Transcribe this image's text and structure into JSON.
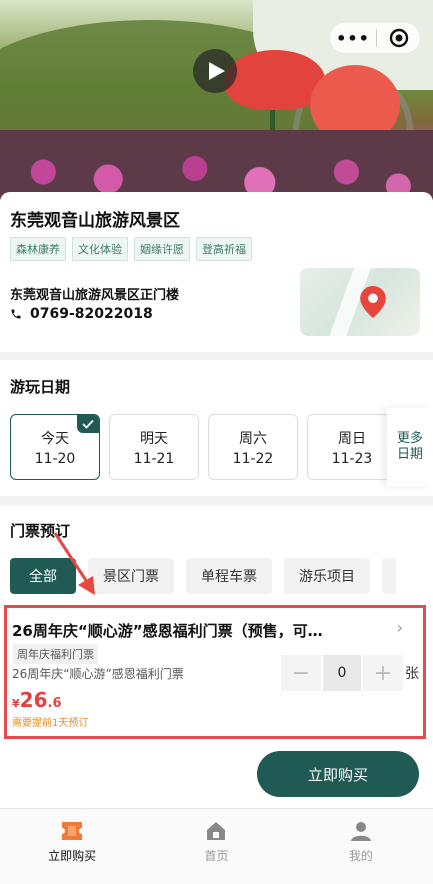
{
  "capsule": {
    "more_icon": "more-dots-icon",
    "close_icon": "close-circle-icon"
  },
  "scenic": {
    "title": "东莞观音山旅游风景区",
    "tags": [
      "森林康养",
      "文化体验",
      "姻缘许愿",
      "登高祈福"
    ],
    "address": "东莞观音山旅游风景区正门楼",
    "phone": "0769-82022018"
  },
  "dates": {
    "title": "游玩日期",
    "items": [
      {
        "day": "今天",
        "date": "11-20",
        "selected": true
      },
      {
        "day": "明天",
        "date": "11-21",
        "selected": false
      },
      {
        "day": "周六",
        "date": "11-22",
        "selected": false
      },
      {
        "day": "周日",
        "date": "11-23",
        "selected": false
      }
    ],
    "more_label": [
      "更多",
      "日期"
    ]
  },
  "tickets": {
    "title": "门票预订",
    "filters": [
      "全部",
      "景区门票",
      "单程车票",
      "游乐项目"
    ],
    "item": {
      "title": "26周年庆“顺心游”感恩福利门票（预售，可…",
      "tag": "周年庆福利门票",
      "subtitle": "26周年庆“顺心游”感恩福利门票",
      "currency": "¥",
      "price_int": "26",
      "price_dec": ".6",
      "note": "需要提前1天预订",
      "quantity": "0",
      "unit": "张"
    },
    "buy_label": "立即购买"
  },
  "tabbar": [
    {
      "label": "立即购买",
      "icon": "ticket-icon",
      "active": true
    },
    {
      "label": "首页",
      "icon": "home-icon",
      "active": false
    },
    {
      "label": "我的",
      "icon": "user-icon",
      "active": false
    }
  ],
  "colors": {
    "accent": "#1f5a54",
    "price": "#e54040",
    "highlight": "#e44a4f",
    "note": "#ef8a1a"
  }
}
